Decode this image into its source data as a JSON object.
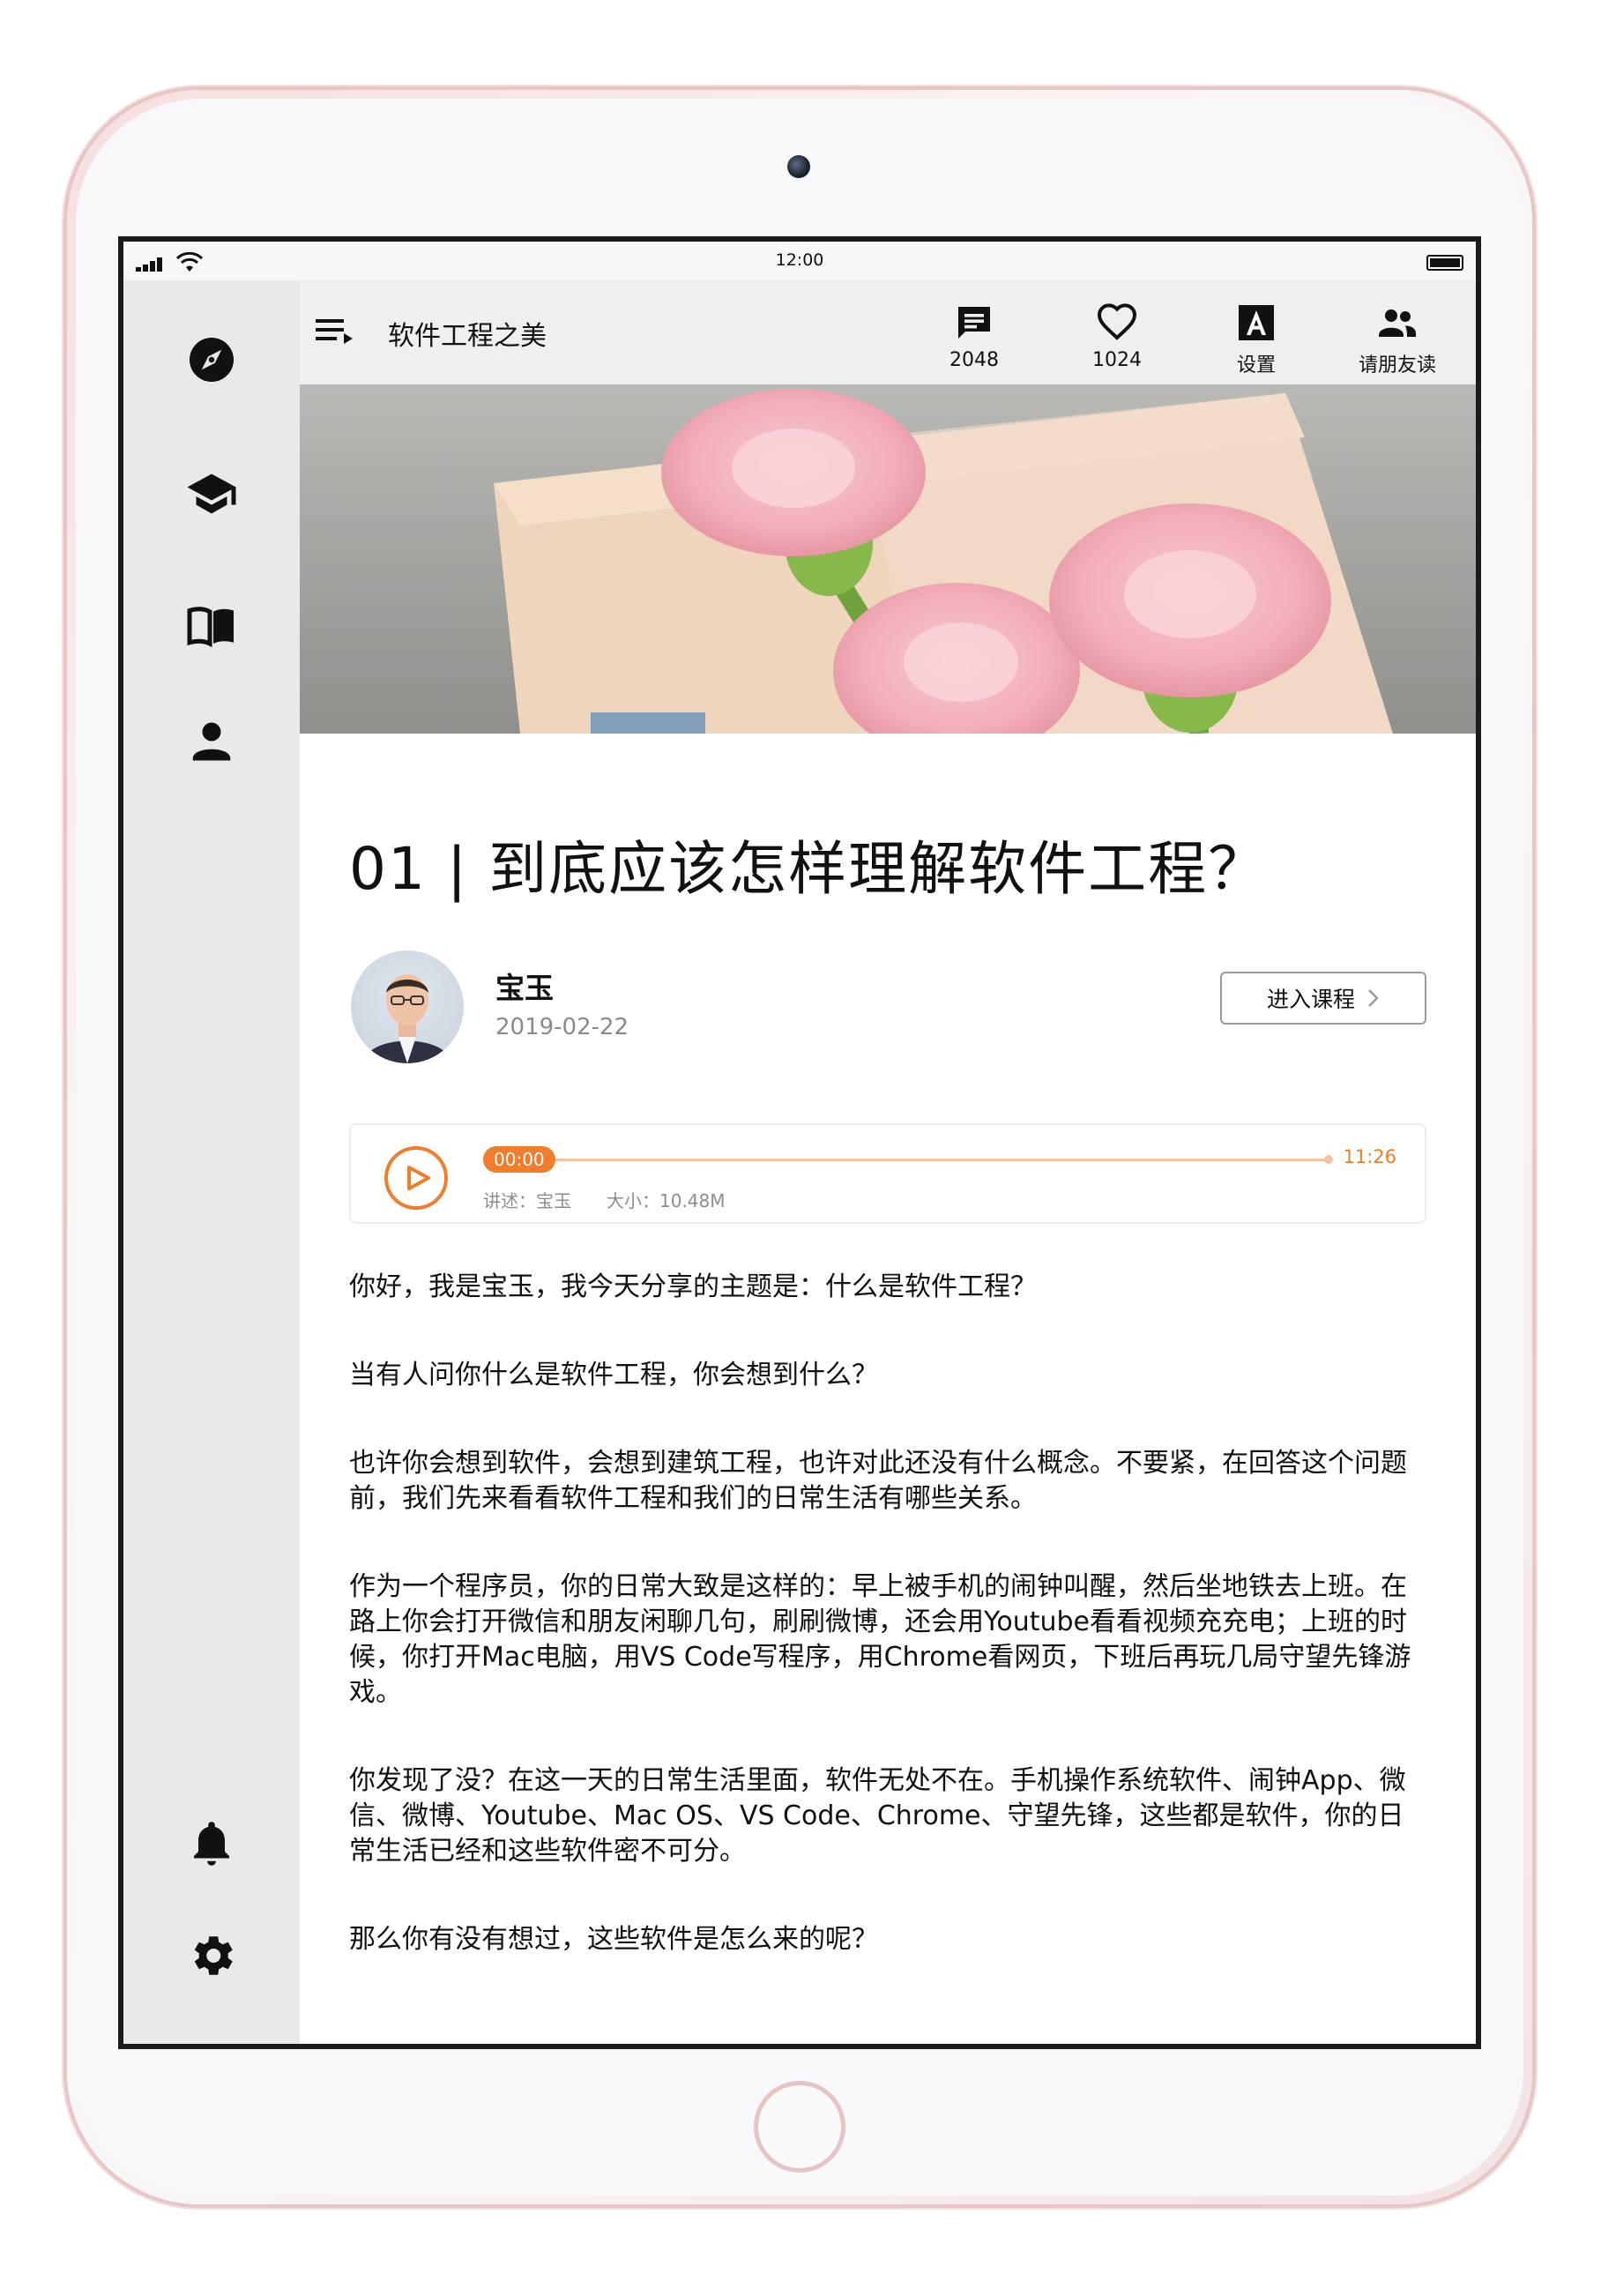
{
  "status_bar": {
    "time": "12:00"
  },
  "header": {
    "title": "软件工程之美",
    "actions": [
      {
        "icon": "comment-icon",
        "label": "2048"
      },
      {
        "icon": "heart-icon",
        "label": "1024"
      },
      {
        "icon": "font-settings-icon",
        "label": "设置"
      },
      {
        "icon": "invite-friends-icon",
        "label": "请朋友读"
      }
    ]
  },
  "sidebar": {
    "items": [
      {
        "icon": "compass-icon"
      },
      {
        "icon": "graduation-cap-icon"
      },
      {
        "icon": "book-icon"
      },
      {
        "icon": "person-icon"
      },
      {
        "icon": "bell-icon"
      },
      {
        "icon": "gear-icon"
      }
    ]
  },
  "article": {
    "title": "01 | 到底应该怎样理解软件工程？",
    "author": "宝玉",
    "date": "2019-02-22",
    "enter_course": "进入课程"
  },
  "player": {
    "current_time": "00:00",
    "total_time": "11:26",
    "progress": 0,
    "narrator": "讲述：宝玉",
    "size": "大小：10.48M"
  },
  "paragraphs": [
    "你好，我是宝玉，我今天分享的主题是：什么是软件工程？",
    "当有人问你什么是软件工程，你会想到什么？",
    "也许你会想到软件，会想到建筑工程，也许对此还没有什么概念。不要紧，在回答这个问题前，我们先来看看软件工程和我们的日常生活有哪些关系。",
    "作为一个程序员，你的日常大致是这样的：早上被手机的闹钟叫醒，然后坐地铁去上班。在路上你会打开微信和朋友闲聊几句，刷刷微博，还会用Youtube看看视频充充电；上班的时候，你打开Mac电脑，用VS Code写程序，用Chrome看网页，下班后再玩几局守望先锋游戏。",
    "你发现了没？在这一天的日常生活里面，软件无处不在。手机操作系统软件、闹钟App、微信、微博、Youtube、Mac OS、VS Code、Chrome、守望先锋，这些都是软件，你的日常生活已经和这些软件密不可分。",
    "那么你有没有想过，这些软件是怎么来的呢？"
  ],
  "colors": {
    "accent": "#f07d2c",
    "sidebar_bg": "#e9e9ea",
    "header_bg": "#efefef"
  }
}
